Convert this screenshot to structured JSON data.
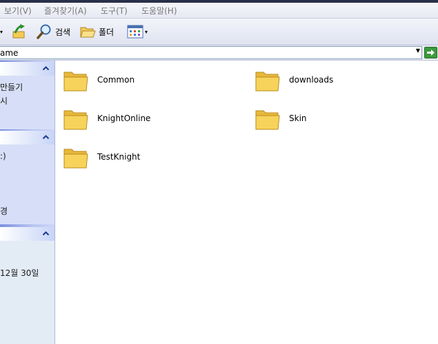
{
  "menu": {
    "items": [
      "보기(V)",
      "즐겨찾기(A)",
      "도구(T)",
      "도움말(H)"
    ]
  },
  "toolbar": {
    "search_label": "검색",
    "folders_label": "폴더"
  },
  "address": {
    "value": "ame"
  },
  "taskpane": {
    "panel1": {
      "items": [
        "만들기",
        "시"
      ]
    },
    "panel2": {
      "items": [
        ":)",
        "경"
      ]
    },
    "panel3": {
      "items": [
        "12월 30일"
      ]
    }
  },
  "files": {
    "items": [
      {
        "name": "Common"
      },
      {
        "name": "downloads"
      },
      {
        "name": "KnightOnline"
      },
      {
        "name": "Skin"
      },
      {
        "name": "TestKnight"
      }
    ]
  },
  "colors": {
    "pane_head": "#ffffff",
    "pane_body": "#d6dff7",
    "folder_fill": "#f7d35b",
    "go_green": "#3a9a3a"
  }
}
